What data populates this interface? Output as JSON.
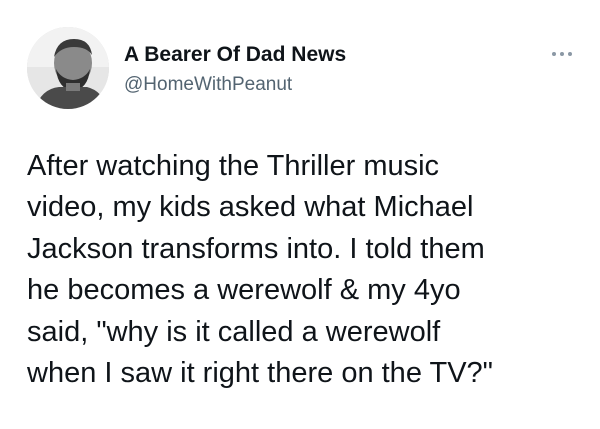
{
  "author": {
    "name": "A Bearer Of Dad News",
    "handle": "@HomeWithPeanut",
    "avatar_icon": "profile-photo"
  },
  "more_icon": "more-horizontal-icon",
  "tweet": {
    "lines": [
      "After watching the Thriller music",
      "video, my kids asked what Michael",
      "Jackson transforms into. I told them",
      "he becomes a werewolf & my 4yo",
      "said, \"why is it called a werewolf",
      "when I saw it right there on the TV?\""
    ]
  },
  "colors": {
    "text": "#0f1419",
    "secondary": "#536471",
    "background": "#ffffff"
  }
}
